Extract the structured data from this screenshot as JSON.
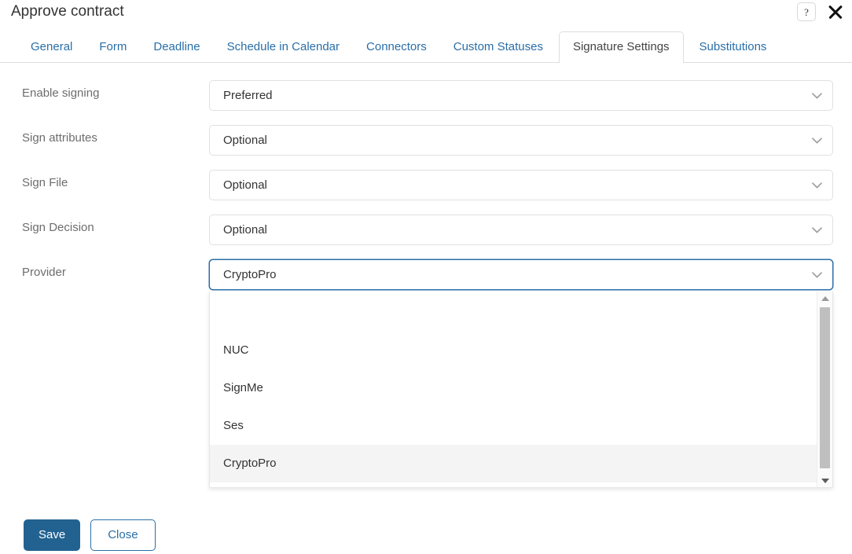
{
  "header": {
    "title": "Approve contract",
    "help_icon": "question-mark-icon",
    "help_label": "?",
    "close_icon": "close-icon"
  },
  "tabs": [
    {
      "label": "General",
      "active": false
    },
    {
      "label": "Form",
      "active": false
    },
    {
      "label": "Deadline",
      "active": false
    },
    {
      "label": "Schedule in Calendar",
      "active": false
    },
    {
      "label": "Connectors",
      "active": false
    },
    {
      "label": "Custom Statuses",
      "active": false
    },
    {
      "label": "Signature Settings",
      "active": true
    },
    {
      "label": "Substitutions",
      "active": false
    }
  ],
  "form": {
    "fields": [
      {
        "label": "Enable signing",
        "value": "Preferred",
        "focused": false
      },
      {
        "label": "Sign attributes",
        "value": "Optional",
        "focused": false
      },
      {
        "label": "Sign File",
        "value": "Optional",
        "focused": false
      },
      {
        "label": "Sign Decision",
        "value": "Optional",
        "focused": false
      },
      {
        "label": "Provider",
        "value": "CryptoPro",
        "focused": true
      }
    ]
  },
  "dropdown": {
    "open": true,
    "owner": "Provider",
    "options": [
      {
        "label": "",
        "selected": false
      },
      {
        "label": "NUC",
        "selected": false
      },
      {
        "label": "SignMe",
        "selected": false
      },
      {
        "label": "Ses",
        "selected": false
      },
      {
        "label": "CryptoPro",
        "selected": true
      }
    ],
    "scrollbar": {
      "up_icon": "caret-up-icon",
      "down_icon": "caret-down-icon"
    }
  },
  "footer": {
    "save_label": "Save",
    "close_label": "Close"
  },
  "colors": {
    "link": "#2a6ea8",
    "primary_button": "#226291",
    "label_text": "#6d6d6d",
    "body_text": "#333333",
    "border": "#e0e0e0",
    "selected_option": "#f4f4f4"
  }
}
